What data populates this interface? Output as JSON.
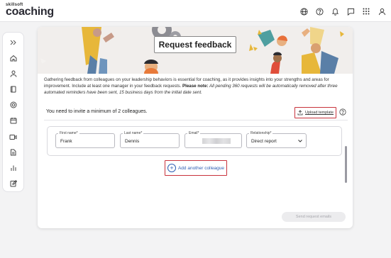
{
  "brand": {
    "line1": "skillsoft",
    "line2": "coaching"
  },
  "top_icons": [
    "globe-icon",
    "help-circle-icon",
    "bell-icon",
    "chat-icon",
    "apps-grid-icon",
    "user-icon"
  ],
  "sidebar": {
    "items": [
      "collapse-icon",
      "home-icon",
      "person-icon",
      "book-icon",
      "target-icon",
      "calendar-icon",
      "video-icon",
      "document-icon",
      "bar-chart-icon",
      "edit-icon"
    ]
  },
  "page": {
    "title": "Request feedback",
    "intro": {
      "text1": "Gathering feedback from colleagues on your leadership behaviors is essential for coaching, as it provides insights into your strengths and areas for improvement. Include at least one manager in your feedback requests. ",
      "note_label": "Please note:",
      "note_text": " All pending 360 requests will be automatically removed after three automated reminders have been sent, 15 business days from the  initial date sent."
    },
    "invite_text": "You need to invite a minimum of 2 colleagues.",
    "upload_label": "Upload template",
    "form": {
      "first_name_label": "First name*",
      "first_name_value": "Frank",
      "last_name_label": "Last name*",
      "last_name_value": "Dennis",
      "email_label": "Email*",
      "relationship_label": "Relationship*",
      "relationship_value": "Direct report"
    },
    "add_label": "Add another colleague",
    "send_label": "Send request emails"
  },
  "colors": {
    "accent": "#c8323c",
    "link": "#2f5fb3"
  }
}
